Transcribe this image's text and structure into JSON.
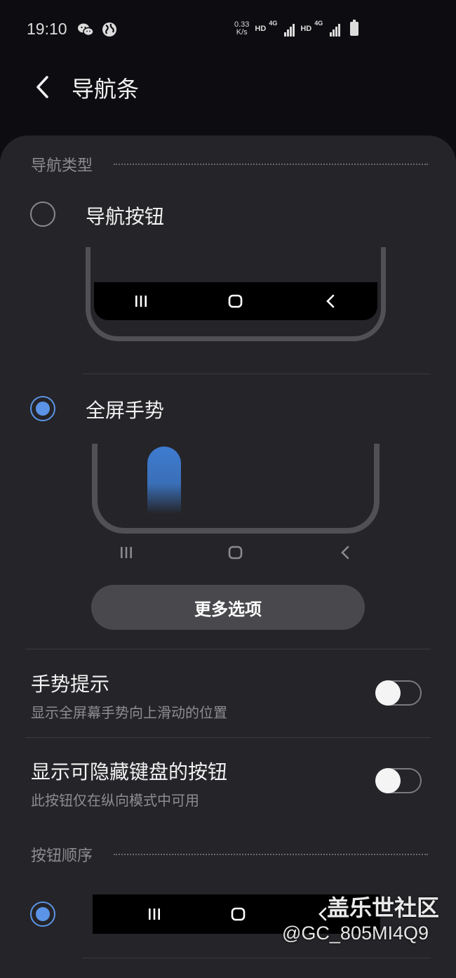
{
  "status_bar": {
    "time": "19:10",
    "speed_value": "0.33",
    "speed_unit": "K/s",
    "sim1_hd": "HD",
    "sim1_net": "4G",
    "sim2_hd": "HD",
    "sim2_net": "4G"
  },
  "header": {
    "title": "导航条"
  },
  "nav_type": {
    "section_label": "导航类型",
    "options": [
      {
        "label": "导航按钮",
        "selected": false
      },
      {
        "label": "全屏手势",
        "selected": true
      }
    ],
    "nav_icons": [
      "recents-icon",
      "home-icon",
      "back-icon"
    ]
  },
  "more_options_label": "更多选项",
  "settings": [
    {
      "title": "手势提示",
      "subtitle": "显示全屏幕手势向上滑动的位置",
      "enabled": false
    },
    {
      "title": "显示可隐藏键盘的按钮",
      "subtitle": "此按钮仅在纵向模式中可用",
      "enabled": false
    }
  ],
  "button_order": {
    "section_label": "按钮顺序",
    "selected": true
  },
  "watermark": {
    "title": "盖乐世社区",
    "handle": "@GC_805MI4Q9"
  },
  "colors": {
    "accent": "#5b94e6",
    "background": "#0d0c10",
    "card": "#252428"
  }
}
